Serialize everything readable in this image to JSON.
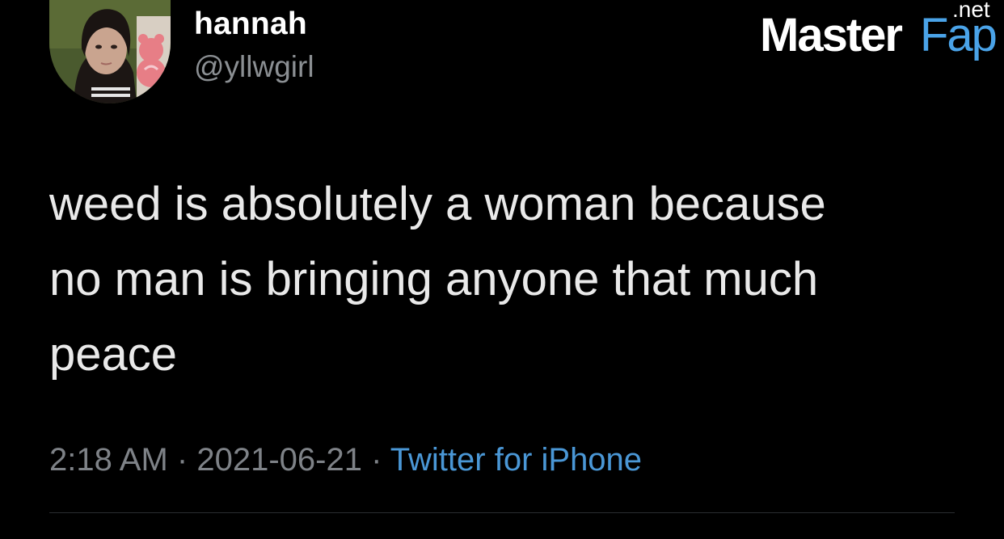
{
  "user": {
    "display_name": "hannah",
    "handle": "@yllwgirl",
    "avatar": "avatar-photo"
  },
  "tweet": {
    "text": "weed is absolutely a woman because\nno man is bringing anyone that much\npeace",
    "time": "2:18 AM",
    "separator": "·",
    "date": "2021-06-21",
    "source": "Twitter for iPhone"
  },
  "watermark": {
    "part1": "Master",
    "part2": "Fap",
    "suffix": ".net"
  },
  "colors": {
    "background": "#000000",
    "text": "#e9e9e9",
    "muted": "#7e8287",
    "link": "#4a97d6",
    "watermark_accent": "#4aa3e8"
  }
}
